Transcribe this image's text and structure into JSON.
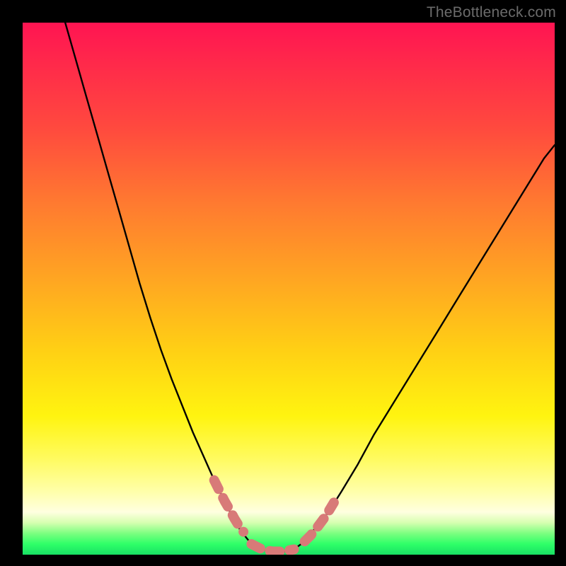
{
  "watermark": "TheBottleneck.com",
  "chart_data": {
    "type": "line",
    "title": "",
    "xlabel": "",
    "ylabel": "",
    "xlim": [
      0,
      100
    ],
    "ylim": [
      0,
      100
    ],
    "series": [
      {
        "name": "left-curve",
        "x": [
          8,
          10,
          12,
          14,
          16,
          18,
          20,
          22,
          24,
          26,
          28,
          30,
          32,
          34,
          36,
          38,
          39.5,
          41,
          43,
          45
        ],
        "y": [
          100,
          93,
          86,
          79,
          72,
          65,
          58,
          51,
          44.5,
          38.5,
          33,
          28,
          23,
          18.5,
          14,
          10,
          7,
          4.5,
          2,
          1
        ]
      },
      {
        "name": "valley-floor",
        "x": [
          45,
          47,
          49,
          51
        ],
        "y": [
          1,
          0.6,
          0.6,
          1
        ]
      },
      {
        "name": "right-curve",
        "x": [
          51,
          53,
          55,
          57.5,
          60,
          63,
          66,
          70,
          74,
          78,
          82,
          86,
          90,
          94,
          98,
          100
        ],
        "y": [
          1,
          2.5,
          5,
          8,
          12,
          17,
          22.5,
          29,
          35.5,
          42,
          48.5,
          55,
          61.5,
          68,
          74.5,
          77
        ]
      }
    ],
    "highlight_segments": [
      {
        "name": "left-lower-highlight",
        "x": [
          36,
          37,
          38,
          39,
          39.8,
          40.6,
          41.5
        ],
        "y": [
          14,
          12,
          10,
          8.3,
          6.8,
          5.5,
          4.3
        ]
      },
      {
        "name": "valley-highlight",
        "x": [
          43,
          45,
          47,
          49,
          51
        ],
        "y": [
          2,
          1,
          0.6,
          0.6,
          1
        ]
      },
      {
        "name": "right-lower-highlight",
        "x": [
          53,
          54.2,
          55.5,
          57,
          58.5
        ],
        "y": [
          2.5,
          3.7,
          5.3,
          7.3,
          9.8
        ]
      }
    ],
    "background_gradient_stops": [
      {
        "pos": 0.0,
        "color": "#ff1452"
      },
      {
        "pos": 0.2,
        "color": "#ff4a3e"
      },
      {
        "pos": 0.48,
        "color": "#ffa522"
      },
      {
        "pos": 0.74,
        "color": "#fff410"
      },
      {
        "pos": 0.92,
        "color": "#ffffe0"
      },
      {
        "pos": 0.98,
        "color": "#2fff68"
      },
      {
        "pos": 1.0,
        "color": "#18e064"
      }
    ]
  }
}
